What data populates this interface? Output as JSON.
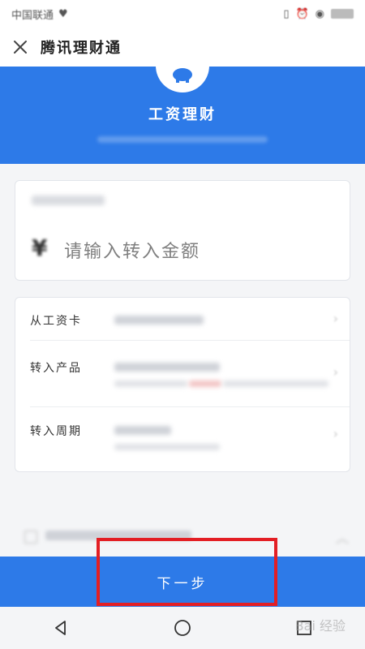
{
  "status_bar": {
    "carrier": "中国联通",
    "icons": [
      "heartbeat-icon",
      "vibrate-icon",
      "alarm-icon",
      "eye-icon",
      "signal-icon",
      "battery-icon"
    ]
  },
  "header": {
    "title": "腾讯理财通",
    "close_icon": "close-icon"
  },
  "hero": {
    "title": "工资理财",
    "logo_icon": "piggy-bank-icon"
  },
  "amount": {
    "currency": "¥",
    "placeholder": "请输入转入金额"
  },
  "details": {
    "rows": [
      {
        "label": "从工资卡"
      },
      {
        "label": "转入产品"
      },
      {
        "label": "转入周期"
      }
    ]
  },
  "footer": {
    "next_label": "下一步"
  },
  "nav": {
    "icons": [
      "back-icon",
      "home-icon",
      "recent-apps-icon"
    ]
  },
  "watermark": "Bai 经验",
  "colors": {
    "primary": "#2d7ae8",
    "highlight": "#e31e24"
  }
}
